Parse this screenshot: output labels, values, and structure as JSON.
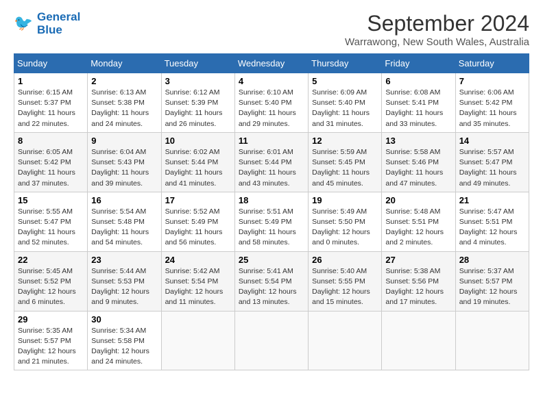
{
  "header": {
    "logo_line1": "General",
    "logo_line2": "Blue",
    "title": "September 2024",
    "subtitle": "Warrawong, New South Wales, Australia"
  },
  "calendar": {
    "days_of_week": [
      "Sunday",
      "Monday",
      "Tuesday",
      "Wednesday",
      "Thursday",
      "Friday",
      "Saturday"
    ],
    "weeks": [
      [
        {
          "day": "1",
          "info": "Sunrise: 6:15 AM\nSunset: 5:37 PM\nDaylight: 11 hours\nand 22 minutes."
        },
        {
          "day": "2",
          "info": "Sunrise: 6:13 AM\nSunset: 5:38 PM\nDaylight: 11 hours\nand 24 minutes."
        },
        {
          "day": "3",
          "info": "Sunrise: 6:12 AM\nSunset: 5:39 PM\nDaylight: 11 hours\nand 26 minutes."
        },
        {
          "day": "4",
          "info": "Sunrise: 6:10 AM\nSunset: 5:40 PM\nDaylight: 11 hours\nand 29 minutes."
        },
        {
          "day": "5",
          "info": "Sunrise: 6:09 AM\nSunset: 5:40 PM\nDaylight: 11 hours\nand 31 minutes."
        },
        {
          "day": "6",
          "info": "Sunrise: 6:08 AM\nSunset: 5:41 PM\nDaylight: 11 hours\nand 33 minutes."
        },
        {
          "day": "7",
          "info": "Sunrise: 6:06 AM\nSunset: 5:42 PM\nDaylight: 11 hours\nand 35 minutes."
        }
      ],
      [
        {
          "day": "8",
          "info": "Sunrise: 6:05 AM\nSunset: 5:42 PM\nDaylight: 11 hours\nand 37 minutes."
        },
        {
          "day": "9",
          "info": "Sunrise: 6:04 AM\nSunset: 5:43 PM\nDaylight: 11 hours\nand 39 minutes."
        },
        {
          "day": "10",
          "info": "Sunrise: 6:02 AM\nSunset: 5:44 PM\nDaylight: 11 hours\nand 41 minutes."
        },
        {
          "day": "11",
          "info": "Sunrise: 6:01 AM\nSunset: 5:44 PM\nDaylight: 11 hours\nand 43 minutes."
        },
        {
          "day": "12",
          "info": "Sunrise: 5:59 AM\nSunset: 5:45 PM\nDaylight: 11 hours\nand 45 minutes."
        },
        {
          "day": "13",
          "info": "Sunrise: 5:58 AM\nSunset: 5:46 PM\nDaylight: 11 hours\nand 47 minutes."
        },
        {
          "day": "14",
          "info": "Sunrise: 5:57 AM\nSunset: 5:47 PM\nDaylight: 11 hours\nand 49 minutes."
        }
      ],
      [
        {
          "day": "15",
          "info": "Sunrise: 5:55 AM\nSunset: 5:47 PM\nDaylight: 11 hours\nand 52 minutes."
        },
        {
          "day": "16",
          "info": "Sunrise: 5:54 AM\nSunset: 5:48 PM\nDaylight: 11 hours\nand 54 minutes."
        },
        {
          "day": "17",
          "info": "Sunrise: 5:52 AM\nSunset: 5:49 PM\nDaylight: 11 hours\nand 56 minutes."
        },
        {
          "day": "18",
          "info": "Sunrise: 5:51 AM\nSunset: 5:49 PM\nDaylight: 11 hours\nand 58 minutes."
        },
        {
          "day": "19",
          "info": "Sunrise: 5:49 AM\nSunset: 5:50 PM\nDaylight: 12 hours\nand 0 minutes."
        },
        {
          "day": "20",
          "info": "Sunrise: 5:48 AM\nSunset: 5:51 PM\nDaylight: 12 hours\nand 2 minutes."
        },
        {
          "day": "21",
          "info": "Sunrise: 5:47 AM\nSunset: 5:51 PM\nDaylight: 12 hours\nand 4 minutes."
        }
      ],
      [
        {
          "day": "22",
          "info": "Sunrise: 5:45 AM\nSunset: 5:52 PM\nDaylight: 12 hours\nand 6 minutes."
        },
        {
          "day": "23",
          "info": "Sunrise: 5:44 AM\nSunset: 5:53 PM\nDaylight: 12 hours\nand 9 minutes."
        },
        {
          "day": "24",
          "info": "Sunrise: 5:42 AM\nSunset: 5:54 PM\nDaylight: 12 hours\nand 11 minutes."
        },
        {
          "day": "25",
          "info": "Sunrise: 5:41 AM\nSunset: 5:54 PM\nDaylight: 12 hours\nand 13 minutes."
        },
        {
          "day": "26",
          "info": "Sunrise: 5:40 AM\nSunset: 5:55 PM\nDaylight: 12 hours\nand 15 minutes."
        },
        {
          "day": "27",
          "info": "Sunrise: 5:38 AM\nSunset: 5:56 PM\nDaylight: 12 hours\nand 17 minutes."
        },
        {
          "day": "28",
          "info": "Sunrise: 5:37 AM\nSunset: 5:57 PM\nDaylight: 12 hours\nand 19 minutes."
        }
      ],
      [
        {
          "day": "29",
          "info": "Sunrise: 5:35 AM\nSunset: 5:57 PM\nDaylight: 12 hours\nand 21 minutes."
        },
        {
          "day": "30",
          "info": "Sunrise: 5:34 AM\nSunset: 5:58 PM\nDaylight: 12 hours\nand 24 minutes."
        },
        null,
        null,
        null,
        null,
        null
      ]
    ]
  }
}
